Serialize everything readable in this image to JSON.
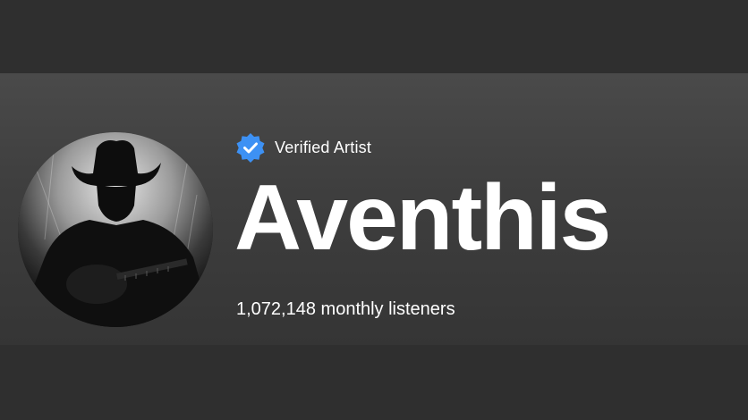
{
  "artist": {
    "verified_label": "Verified Artist",
    "name": "Aventhis",
    "monthly_listeners": "1,072,148 monthly listeners"
  },
  "icons": {
    "verified": "verified-badge-icon",
    "avatar": "artist-avatar-image"
  },
  "colors": {
    "verified_badge": "#3d91f4",
    "text": "#ffffff",
    "page_background": "#2f2f2f"
  }
}
